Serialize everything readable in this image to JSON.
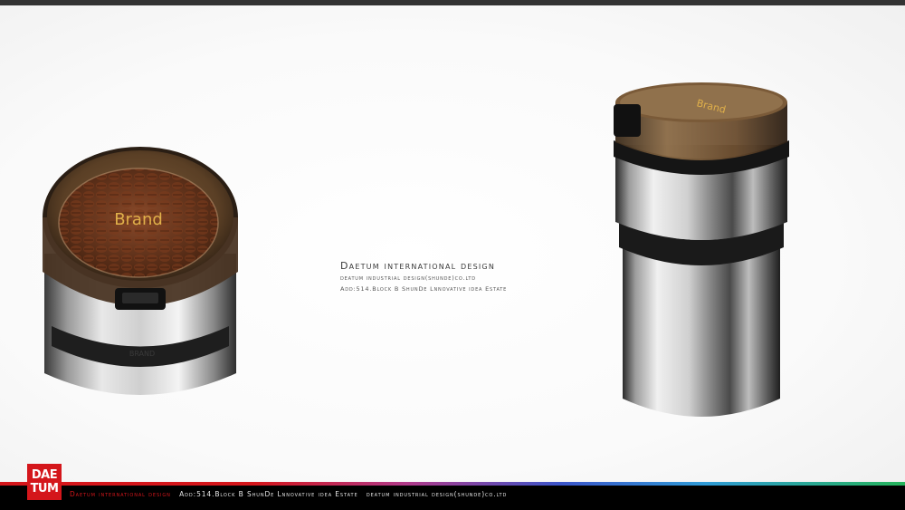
{
  "header": {
    "bar_color": "#333333"
  },
  "products": {
    "left": {
      "lid_label": "Brand",
      "band_label": "BRAND"
    },
    "right": {
      "lid_label": "Brand"
    }
  },
  "center": {
    "title": "Daetum international design",
    "line1": "deatum industrial design(shunde)co.ltd",
    "line2": "Add:514.Block B ShunDe Lnnovative idea Estate"
  },
  "footer": {
    "logo_line1": "DAE",
    "logo_line2": "TUM",
    "company": "Daetum international design",
    "address": "Add:514.Block B ShunDe Lnnovative idea Estate",
    "legal": "deatum industrial design(shunde)co.ltd",
    "accent_color": "#d4161b"
  }
}
